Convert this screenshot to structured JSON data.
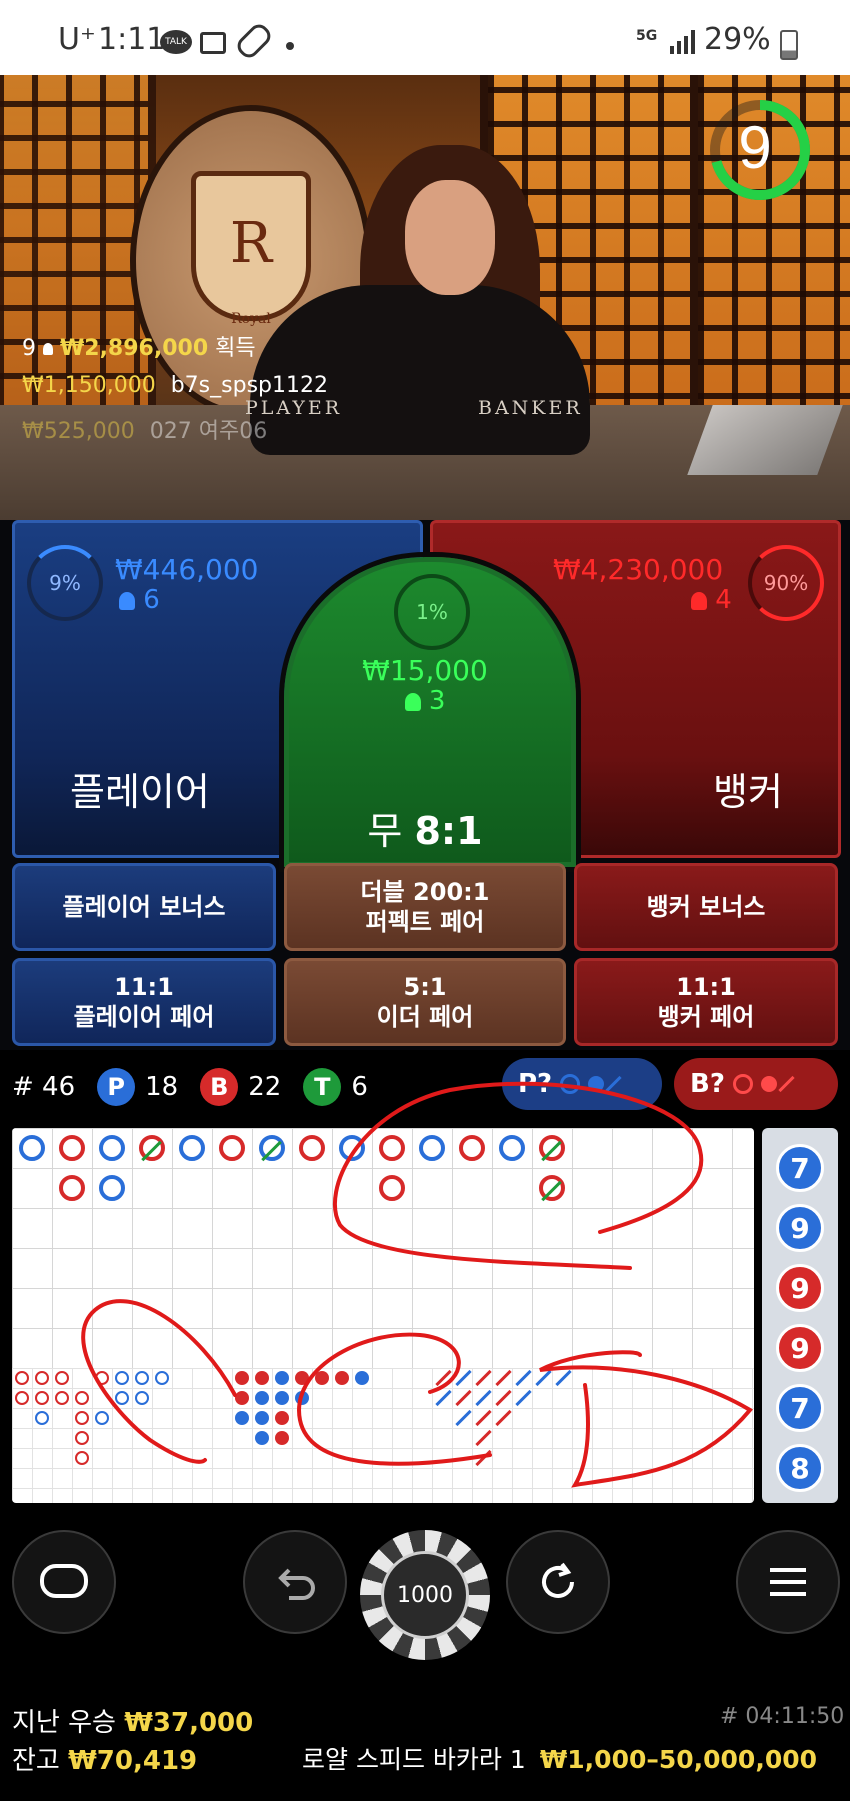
{
  "status_bar": {
    "carrier": "U⁺",
    "time": "1:11",
    "network": "5G",
    "battery": "29%"
  },
  "video": {
    "countdown": "9",
    "felt_player": "PLAYER",
    "felt_banker": "BANKER",
    "logo_letter": "R",
    "logo_text": "Royal",
    "win_feed": [
      {
        "prefix": "9",
        "amount": "₩2,896,000",
        "suffix": "획득"
      },
      {
        "prefix": "",
        "amount": "₩1,150,000",
        "suffix": "b7s_spsp1122"
      },
      {
        "prefix": "",
        "amount": "₩525,000",
        "suffix": "027 여주06"
      }
    ]
  },
  "bets": {
    "player": {
      "label": "플레이어",
      "percent": "9%",
      "percent_value": 9,
      "amount": "₩446,000",
      "players": "6"
    },
    "tie": {
      "label": "무",
      "odds": "8:1",
      "percent": "1%",
      "amount": "₩15,000",
      "players": "3"
    },
    "banker": {
      "label": "뱅커",
      "percent": "90%",
      "percent_value": 90,
      "amount": "₩4,230,000",
      "players": "4"
    }
  },
  "side_bets": [
    {
      "line1": "플레이어 보너스",
      "line2": ""
    },
    {
      "line1": "더블 200:1",
      "line2": "퍼펙트 페어"
    },
    {
      "line1": "뱅커 보너스",
      "line2": ""
    },
    {
      "line1": "11:1",
      "line2": "플레이어 페어"
    },
    {
      "line1": "5:1",
      "line2": "이더 페어"
    },
    {
      "line1": "11:1",
      "line2": "뱅커 페어"
    }
  ],
  "stats": {
    "round": "# 46",
    "p_label": "P",
    "p_count": "18",
    "b_label": "B",
    "b_count": "22",
    "t_label": "T",
    "t_count": "6",
    "ask_player": "P?",
    "ask_banker": "B?"
  },
  "side_strip": [
    "7",
    "9",
    "9",
    "9",
    "7",
    "8"
  ],
  "controls": {
    "chip_value": "1000"
  },
  "footer": {
    "last_win_label": "지난 우승",
    "last_win_amount": "₩37,000",
    "balance_label": "잔고",
    "balance_amount": "₩70,419",
    "round_time": "# 04:11:50",
    "table_name": "로얄 스피드 바카라 1",
    "limits": "₩1,000–50,000,000"
  },
  "colors": {
    "player": "#2a6ed8",
    "banker": "#d62a2a",
    "tie": "#1e9a3a",
    "accent_yellow": "#f4d64a",
    "annotation": "#e01a1a"
  }
}
